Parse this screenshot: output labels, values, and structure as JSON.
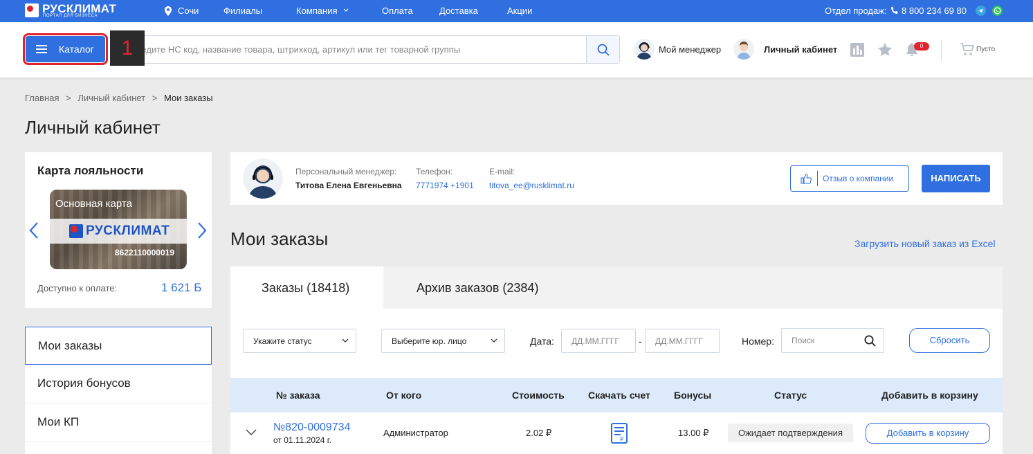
{
  "topbar": {
    "logo_name": "РУСКЛИМАТ",
    "logo_sub": "ПОРТАЛ ДЛЯ БИЗНЕСА",
    "city": "Сочи",
    "nav": [
      "Филиалы",
      "Компания",
      "Оплата",
      "Доставка",
      "Акции"
    ],
    "sales_label": "Отдел продаж:",
    "phone": "8 800 234 69 80"
  },
  "header": {
    "catalog_label": "Каталог",
    "step_badge": "1",
    "search_placeholder": "Введите НС код, название товара, штрихкод, артикул или тег товарной группы",
    "my_manager": "Мой менеджер",
    "account": "Личный кабинет",
    "notification_count": "0",
    "cart_label": "Пусто"
  },
  "breadcrumb": [
    "Главная",
    ">",
    "Личный кабинет",
    ">",
    "Мои заказы"
  ],
  "page_title": "Личный кабинет",
  "loyalty": {
    "title": "Карта лояльности",
    "card_title": "Основная карта",
    "card_brand": "РУСКЛИМАТ",
    "card_number": "8622110000019",
    "available_label": "Доступно к оплате:",
    "available_value": "1 621 Б"
  },
  "sidebar": {
    "items": [
      {
        "label": "Мои заказы"
      },
      {
        "label": "История бонусов"
      },
      {
        "label": "Мои КП"
      }
    ]
  },
  "manager": {
    "label": "Персональный менеджер:",
    "name": "Титова Елена Евгеньевна",
    "phone_label": "Телефон:",
    "phone": "7771974 +1901",
    "email_label": "E-mail:",
    "email": "titova_ee@rusklimat.ru",
    "review_button": "Отзыв о компании",
    "write_button": "НАПИСАТЬ"
  },
  "orders": {
    "title": "Мои заказы",
    "upload_link": "Загрузить новый заказ из Excel",
    "tabs": [
      {
        "label": "Заказы (18418)"
      },
      {
        "label": "Архив заказов (2384)"
      }
    ],
    "filters": {
      "status": "Укажите статус",
      "entity": "Выберите юр. лицо",
      "date_label": "Дата:",
      "date_from_placeholder": "ДД.ММ.ГГГГ",
      "date_sep": "-",
      "date_to_placeholder": "ДД.ММ.ГГГГ",
      "number_label": "Номер:",
      "number_placeholder": "Поиск",
      "reset": "Сбросить"
    },
    "columns": [
      "№ заказа",
      "От кого",
      "Стоимость",
      "Скачать счет",
      "Бонусы",
      "Статус",
      "Добавить в корзину"
    ],
    "rows": [
      {
        "number": "№820-0009734",
        "date": "от 01.11.2024 г.",
        "from": "Администратор",
        "cost": "2.02 ₽",
        "bonus": "13.00 ₽",
        "status": "Ожидает подтверждения",
        "add_to_cart": "Добавить в корзину"
      }
    ]
  },
  "colors": {
    "brand_blue": "#2f6fe0",
    "brand_red": "#e0242c",
    "link_blue": "#2f6fe0"
  }
}
